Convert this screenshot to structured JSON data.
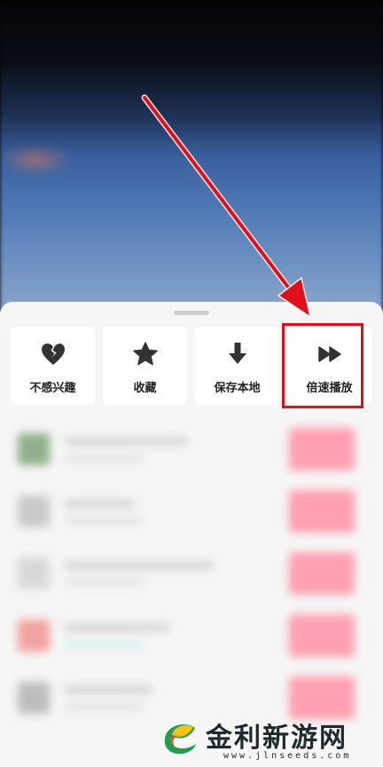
{
  "video": {
    "description_hidden": true
  },
  "sheet": {
    "actions": [
      {
        "id": "not-interested",
        "label": "不感兴趣",
        "icon": "broken-heart-icon"
      },
      {
        "id": "favorite",
        "label": "收藏",
        "icon": "star-icon"
      },
      {
        "id": "save-local",
        "label": "保存本地",
        "icon": "download-arrow-icon"
      },
      {
        "id": "speed",
        "label": "倍速播放",
        "icon": "fast-forward-icon"
      }
    ]
  },
  "annotation": {
    "highlight_color": "#e0101a",
    "arrow_color": "#e0101a"
  },
  "watermark": {
    "title": "金利新游网",
    "url": "www.jlnseeds.com"
  }
}
